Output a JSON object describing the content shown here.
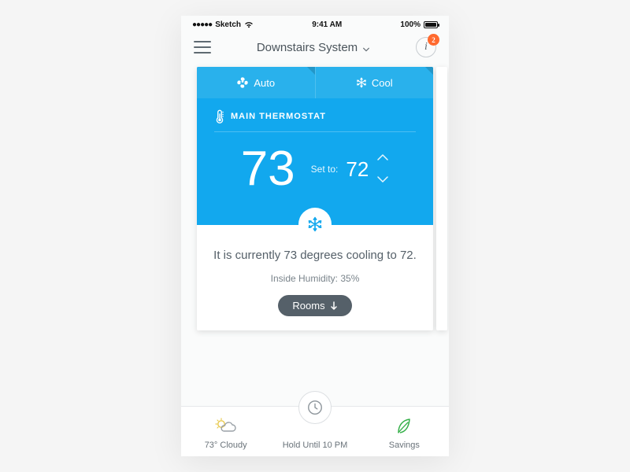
{
  "statusbar": {
    "carrier": "Sketch",
    "time": "9:41 AM",
    "battery_pct": "100%"
  },
  "header": {
    "title": "Downstairs System",
    "badge_count": "2"
  },
  "card": {
    "mode_auto_label": "Auto",
    "mode_cool_label": "Cool",
    "thermostat_label": "MAIN THERMOSTAT",
    "current_temp": "73",
    "set_to_label": "Set to:",
    "set_temp": "72",
    "status_line": "It is currently 73 degrees cooling to 72.",
    "humidity_line": "Inside Humidity: 35%",
    "rooms_label": "Rooms"
  },
  "tabs": {
    "weather_label": "73° Cloudy",
    "hold_label": "Hold Until 10 PM",
    "savings_label": "Savings"
  },
  "colors": {
    "accent_blue": "#12a8ee",
    "badge_orange": "#ff6a2f",
    "pill_gray": "#556069",
    "leaf_green": "#36b04a",
    "sun_yellow": "#e8c94d"
  }
}
